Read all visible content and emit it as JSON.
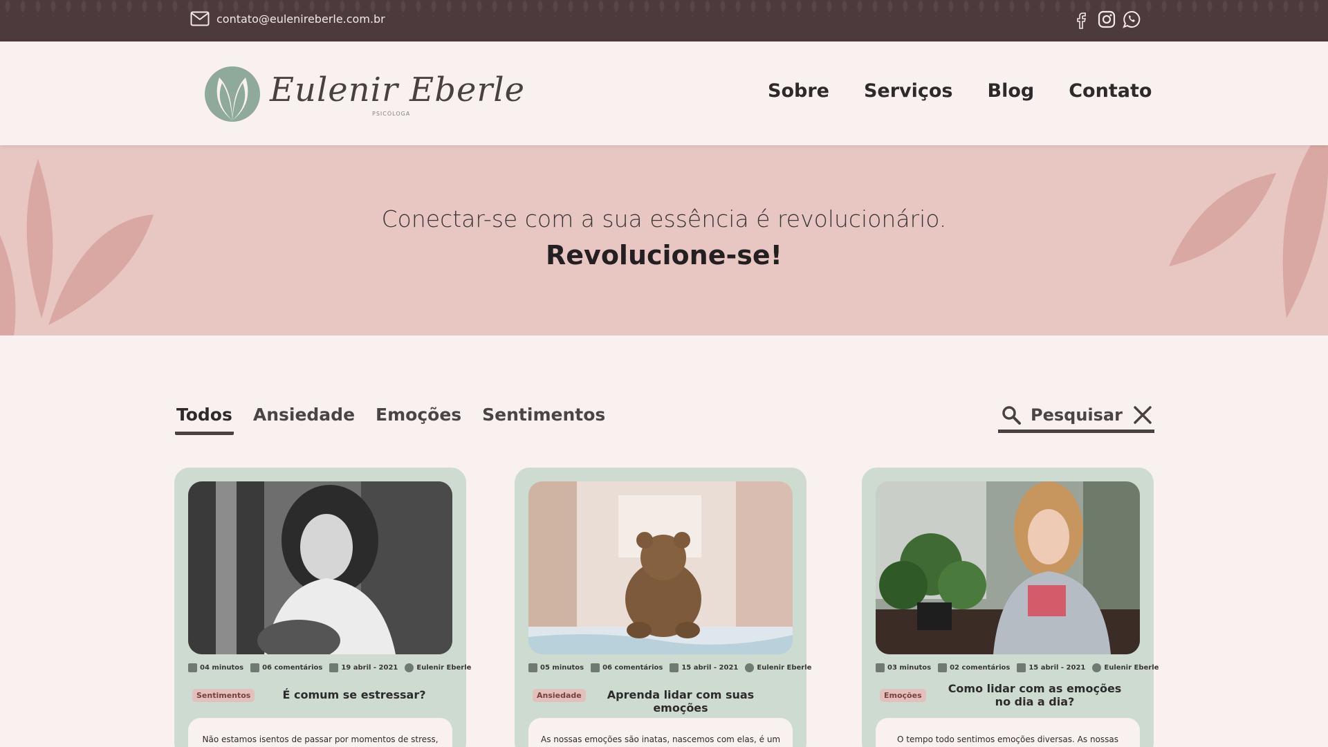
{
  "topbar": {
    "email": "contato@eulenireberle.com.br",
    "social": [
      "facebook-icon",
      "instagram-icon",
      "whatsapp-icon"
    ]
  },
  "header": {
    "logo_name": "Eulenir Eberle",
    "logo_sub": "PSICÓLOGA",
    "nav": [
      "Sobre",
      "Serviços",
      "Blog",
      "Contato"
    ]
  },
  "hero": {
    "line1": "Conectar-se com a sua essência é revolucionário.",
    "line2": "Revolucione-se!"
  },
  "filters": {
    "tabs": [
      "Todos",
      "Ansiedade",
      "Emoções",
      "Sentimentos"
    ],
    "active": "Todos"
  },
  "search": {
    "placeholder": "Pesquisar"
  },
  "cards": [
    {
      "read_time": "04 minutos",
      "comments": "06 comentários",
      "date": "19 abril - 2021",
      "author": "Eulenir Eberle",
      "category": "Sentimentos",
      "title": "É comum se estressar?",
      "excerpt": "Não estamos isentos de passar por momentos de stress,"
    },
    {
      "read_time": "05 minutos",
      "comments": "06 comentários",
      "date": "15 abril - 2021",
      "author": "Eulenir Eberle",
      "category": "Ansiedade",
      "title": "Aprenda lidar com suas emoções",
      "excerpt": "As nossas emoções são inatas, nascemos com elas, é um"
    },
    {
      "read_time": "03 minutos",
      "comments": "02 comentários",
      "date": "15 abril - 2021",
      "author": "Eulenir Eberle",
      "category": "Emoções",
      "title": "Como lidar com as emoções no dia a dia?",
      "excerpt": "O tempo todo sentimos emoções diversas. As nossas"
    }
  ],
  "colors": {
    "topbar": "#4c3a3c",
    "hero": "#e8c7c2",
    "card": "#cddbd0",
    "accent": "#4a3f41",
    "badge": "#e2c1bd"
  }
}
